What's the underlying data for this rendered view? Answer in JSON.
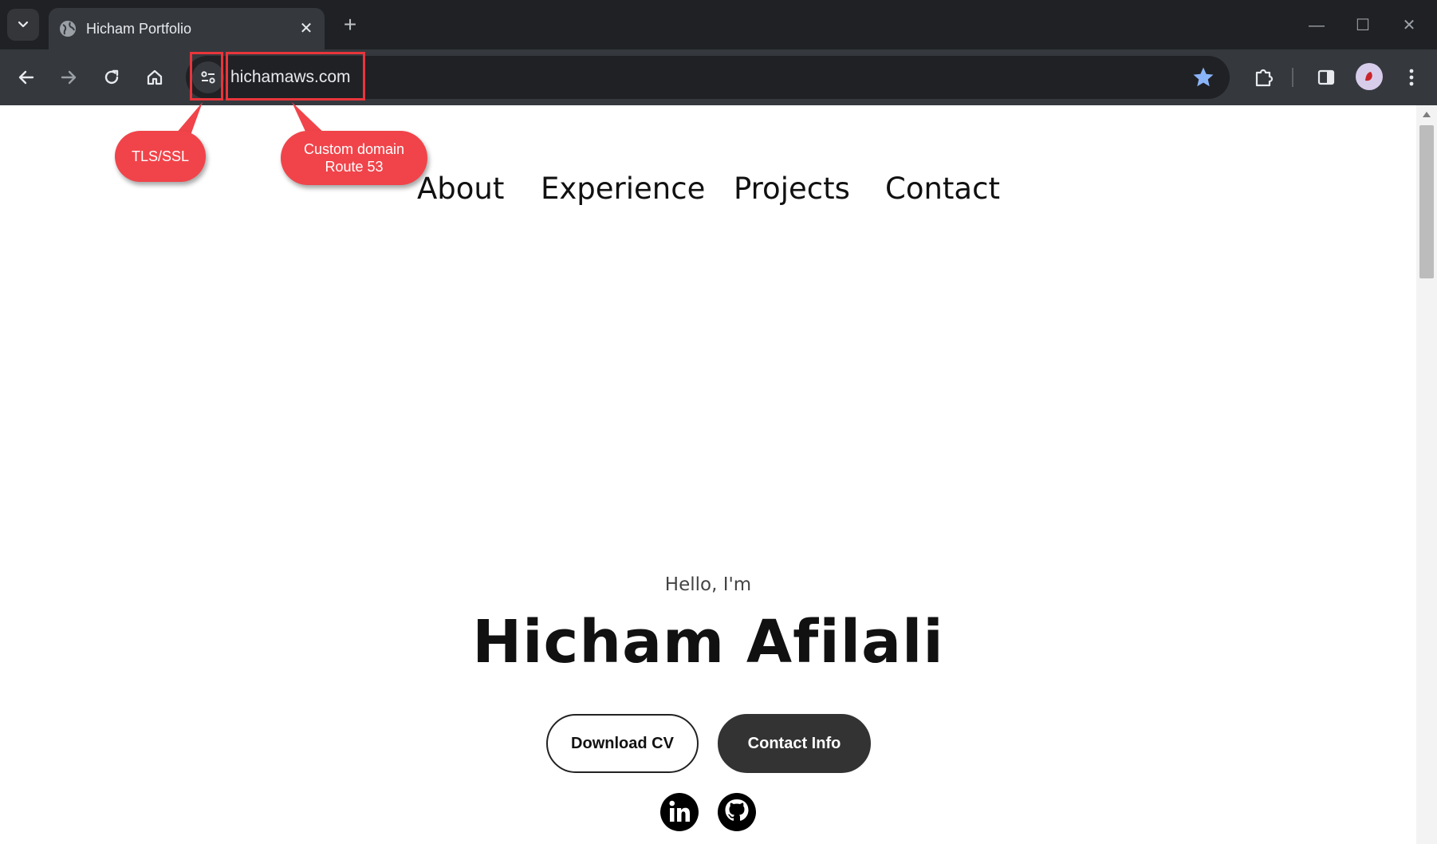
{
  "browser": {
    "tab_title": "Hicham Portfolio",
    "tab_close_glyph": "✕",
    "new_tab_glyph": "+",
    "minimize_glyph": "—",
    "maximize_glyph": "☐",
    "close_glyph": "✕",
    "url": "hichamaws.com",
    "icons": {
      "tab_search": "chevron-down-icon",
      "favicon": "globe-icon",
      "back": "arrow-left-icon",
      "forward": "arrow-right-icon",
      "reload": "reload-icon",
      "home": "home-icon",
      "site_info": "tune-icon",
      "bookmark": "star-icon",
      "extensions": "puzzle-icon",
      "side_panel": "side-panel-icon",
      "profile": "avatar",
      "menu": "kebab-menu-icon"
    },
    "colors": {
      "bookmark_star": "#8ab4f8",
      "annotation": "#f0444a"
    }
  },
  "annotations": {
    "tls": "TLS/SSL",
    "domain_line1": "Custom domain",
    "domain_line2": "Route 53"
  },
  "site": {
    "nav": [
      "About",
      "Experience",
      "Projects",
      "Contact"
    ],
    "hello": "Hello, I'm",
    "name": "Hicham Afilali",
    "buttons": {
      "download_cv": "Download CV",
      "contact_info": "Contact Info"
    },
    "social": [
      "linkedin-icon",
      "github-icon"
    ]
  }
}
